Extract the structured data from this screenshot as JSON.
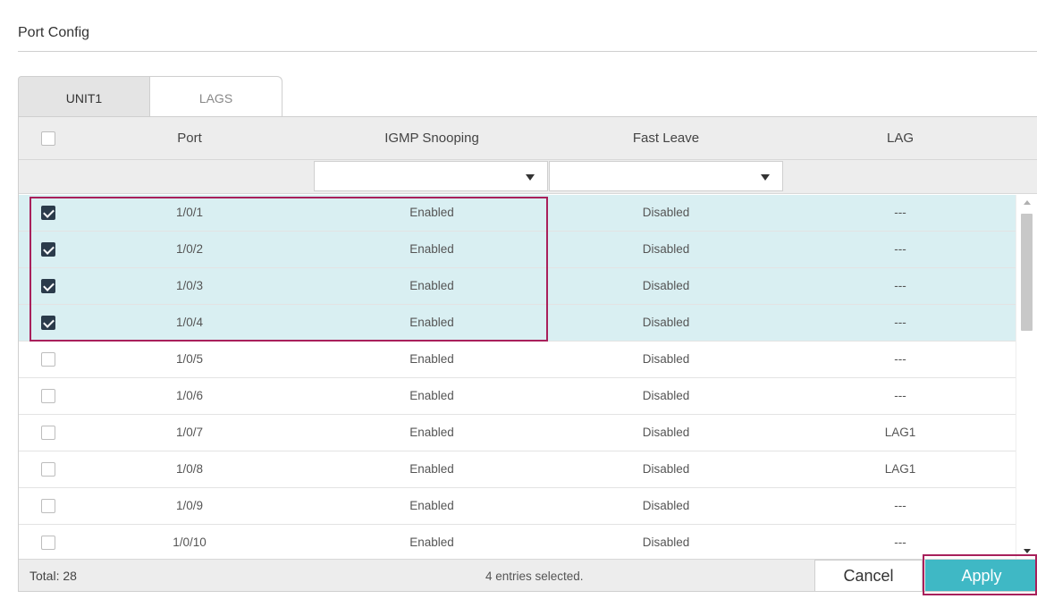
{
  "panel": {
    "title": "Port Config"
  },
  "tabs": [
    {
      "label": "UNIT1",
      "active": true
    },
    {
      "label": "LAGS",
      "active": false
    }
  ],
  "table": {
    "columns": [
      "Port",
      "IGMP Snooping",
      "Fast Leave",
      "LAG"
    ],
    "filter": {
      "igmp_snooping": "",
      "fast_leave": ""
    },
    "rows": [
      {
        "checked": true,
        "port": "1/0/1",
        "igmp": "Enabled",
        "fast_leave": "Disabled",
        "lag": "---"
      },
      {
        "checked": true,
        "port": "1/0/2",
        "igmp": "Enabled",
        "fast_leave": "Disabled",
        "lag": "---"
      },
      {
        "checked": true,
        "port": "1/0/3",
        "igmp": "Enabled",
        "fast_leave": "Disabled",
        "lag": "---"
      },
      {
        "checked": true,
        "port": "1/0/4",
        "igmp": "Enabled",
        "fast_leave": "Disabled",
        "lag": "---"
      },
      {
        "checked": false,
        "port": "1/0/5",
        "igmp": "Enabled",
        "fast_leave": "Disabled",
        "lag": "---"
      },
      {
        "checked": false,
        "port": "1/0/6",
        "igmp": "Enabled",
        "fast_leave": "Disabled",
        "lag": "---"
      },
      {
        "checked": false,
        "port": "1/0/7",
        "igmp": "Enabled",
        "fast_leave": "Disabled",
        "lag": "LAG1"
      },
      {
        "checked": false,
        "port": "1/0/8",
        "igmp": "Enabled",
        "fast_leave": "Disabled",
        "lag": "LAG1"
      },
      {
        "checked": false,
        "port": "1/0/9",
        "igmp": "Enabled",
        "fast_leave": "Disabled",
        "lag": "---"
      },
      {
        "checked": false,
        "port": "1/0/10",
        "igmp": "Enabled",
        "fast_leave": "Disabled",
        "lag": "---"
      }
    ]
  },
  "footer": {
    "total": "Total: 28",
    "selected_info": "4 entries selected.",
    "cancel_label": "Cancel",
    "apply_label": "Apply"
  },
  "colors": {
    "selected_row_bg": "#d9eff2",
    "apply_bg": "#3fb8c5",
    "highlight_border": "#a8205b",
    "checkbox_checked": "#2b3b4b"
  }
}
